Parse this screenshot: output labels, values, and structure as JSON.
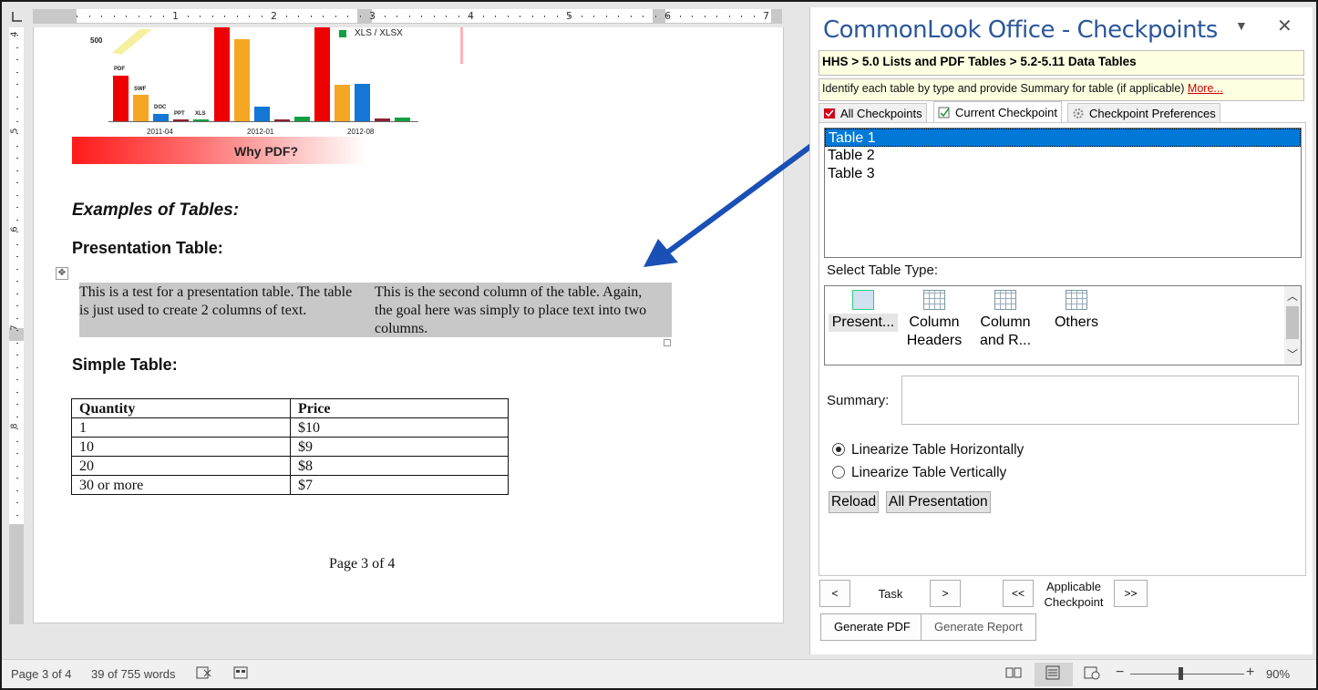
{
  "ruler": {
    "h_numbers": [
      "1",
      "2",
      "3",
      "4",
      "5",
      "6",
      "7"
    ],
    "v_numbers": [
      "4",
      "5",
      "6",
      "7",
      "8"
    ]
  },
  "document": {
    "chart": {
      "legend": "XLS / XLSX",
      "y_label": "500",
      "bar_labels": [
        "PDF",
        "SWF",
        "DOC",
        "PPT",
        "XLS"
      ],
      "periods": [
        "2011-04",
        "2012-01",
        "2012-08"
      ],
      "caption": "Why PDF?"
    },
    "examples_heading": "Examples of Tables:",
    "presentation_heading": "Presentation Table:",
    "presentation_table": {
      "col1": "This is a test for a presentation table. The table is just used to create 2 columns of text.",
      "col2": "This is the second column of the table. Again, the goal here was simply to place text into two columns."
    },
    "simple_heading": "Simple Table:",
    "simple_table": {
      "headers": [
        "Quantity",
        "Price"
      ],
      "rows": [
        [
          "1",
          "$10"
        ],
        [
          "10",
          "$9"
        ],
        [
          "20",
          "$8"
        ],
        [
          "30 or more",
          "$7"
        ]
      ]
    },
    "page_footer": "Page 3 of 4"
  },
  "panel": {
    "title": "CommonLook Office - Checkpoints",
    "menu_icon": "chevron-down-icon",
    "close_icon": "close-icon",
    "breadcrumb": "HHS > 5.0 Lists and PDF Tables > 5.2-5.11 Data Tables",
    "description": "Identify each table by type and provide Summary for table (if applicable)",
    "more_link": "More...",
    "tabs": [
      {
        "label": "All Checkpoints",
        "icon": "checklist-red-icon"
      },
      {
        "label": "Current Checkpoint",
        "icon": "checkpoint-icon"
      },
      {
        "label": "Checkpoint Preferences",
        "icon": "gear-icon"
      }
    ],
    "tables": [
      "Table 1",
      "Table 2",
      "Table 3"
    ],
    "selected_table": "Table 1",
    "select_type_label": "Select Table Type:",
    "table_types": [
      {
        "line1": "Present...",
        "line2": ""
      },
      {
        "line1": "Column",
        "line2": "Headers"
      },
      {
        "line1": "Column",
        "line2": "and R..."
      },
      {
        "line1": "Others",
        "line2": ""
      }
    ],
    "summary_label": "Summary:",
    "summary_value": "",
    "radio_horizontal": "Linearize Table Horizontally",
    "radio_vertical": "Linearize Table Vertically",
    "radio_selected": "horizontal",
    "reload_label": "Reload",
    "all_presentation_label": "All Presentation",
    "nav": {
      "prev": "<",
      "task": "Task",
      "next": ">",
      "first": "<<",
      "applicable_line1": "Applicable",
      "applicable_line2": "Checkpoint",
      "last": ">>"
    },
    "generate_pdf": "Generate PDF",
    "generate_report": "Generate Report"
  },
  "status_bar": {
    "page": "Page 3 of 4",
    "words": "39 of 755 words",
    "zoom_minus": "−",
    "zoom_plus": "+",
    "zoom": "90%"
  },
  "colors": {
    "accent": "#2b579a",
    "selection": "#0078d7",
    "arrow": "#1a4fb5"
  }
}
